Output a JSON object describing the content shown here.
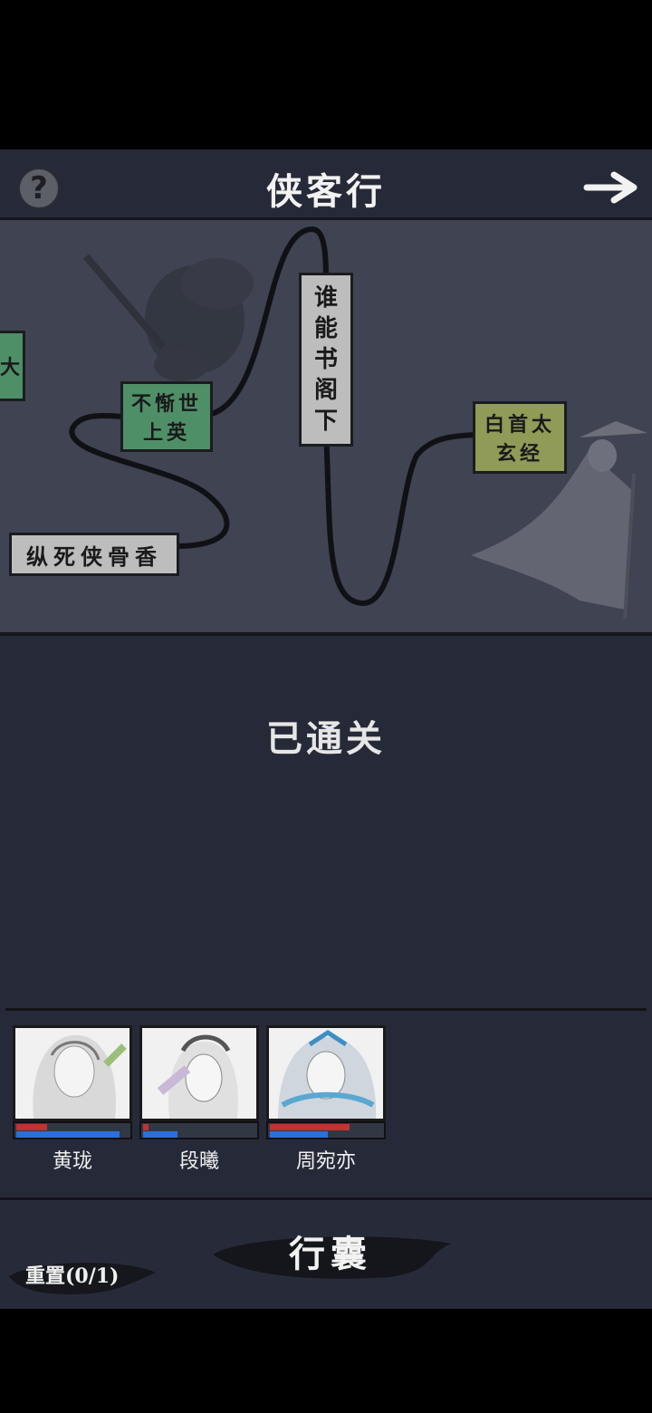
{
  "header": {
    "title": "侠客行",
    "help_icon": "question-mark-icon",
    "next_icon": "arrow-right-icon"
  },
  "map": {
    "nodes": [
      {
        "label_line1": "纵死侠骨香",
        "label_line2": "",
        "color": "#bdbdbd"
      },
      {
        "label_line1": "不惭世",
        "label_line2": "上英",
        "color": "#4f8f68"
      },
      {
        "label_line1": "谁能书阁下",
        "label_line2": "",
        "color": "#bdbdbd"
      },
      {
        "label_line1": "白首太",
        "label_line2": "玄经",
        "color": "#8f9b57"
      },
      {
        "label_line1": "大",
        "label_line2": "",
        "color": "#4f8f68"
      }
    ]
  },
  "status": {
    "text": "已通关"
  },
  "party": {
    "members": [
      {
        "name": "黄珑",
        "hp": 0.28,
        "mp": 0.9
      },
      {
        "name": "段曦",
        "hp": 0.05,
        "mp": 0.3
      },
      {
        "name": "周宛亦",
        "hp": 0.7,
        "mp": 0.5
      }
    ]
  },
  "footer": {
    "bag_label": "行囊",
    "reset_label": "重置(0/1)"
  }
}
